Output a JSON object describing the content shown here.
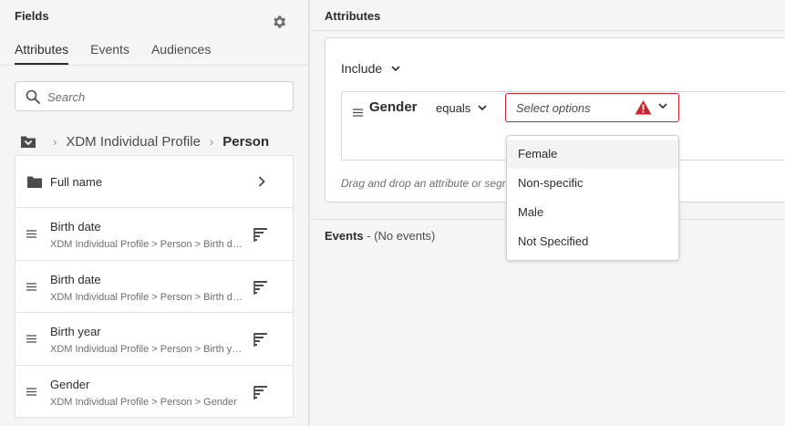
{
  "left_panel": {
    "title": "Fields",
    "tabs": [
      {
        "label": "Attributes",
        "active": true
      },
      {
        "label": "Events",
        "active": false
      },
      {
        "label": "Audiences",
        "active": false
      }
    ],
    "search_placeholder": "Search",
    "breadcrumb": {
      "icon": "folder-down-icon",
      "items": [
        "XDM Individual Profile",
        "Person"
      ]
    },
    "folder_row": {
      "label": "Full name",
      "icon": "folder-icon"
    },
    "attribute_rows": [
      {
        "name": "Birth date",
        "path": "XDM Individual Profile > Person > Birth date"
      },
      {
        "name": "Birth date",
        "path": "XDM Individual Profile > Person > Birth date"
      },
      {
        "name": "Birth year",
        "path": "XDM Individual Profile > Person > Birth year"
      },
      {
        "name": "Gender",
        "path": "XDM Individual Profile > Person > Gender"
      }
    ]
  },
  "right_panel": {
    "title": "Attributes",
    "include_label": "Include",
    "rule": {
      "attribute": "Gender",
      "operator": "equals",
      "value_placeholder": "Select options"
    },
    "drop_hint": "Drag and drop an attribute or segment",
    "events_label": "Events",
    "events_status": " - (No events)"
  },
  "dropdown": {
    "options": [
      "Female",
      "Non-specific",
      "Male",
      "Not Specified"
    ],
    "hovered_index": 0
  },
  "colors": {
    "error": "#c9252d",
    "panel_bg": "#f5f5f5",
    "text": "#2c2c2c"
  }
}
